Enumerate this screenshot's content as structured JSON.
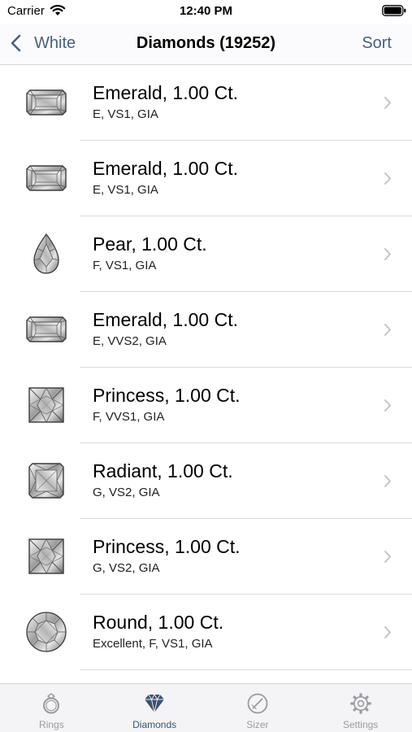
{
  "status_bar": {
    "carrier": "Carrier",
    "time": "12:40 PM",
    "icons": [
      "wifi-icon",
      "battery-icon"
    ]
  },
  "nav": {
    "back_label": "White",
    "title": "Diamonds (19252)",
    "sort_label": "Sort",
    "accent_color": "#4a5f7e"
  },
  "diamonds": [
    {
      "shape": "emerald",
      "title": "Emerald, 1.00 Ct.",
      "details": "E, VS1, GIA"
    },
    {
      "shape": "emerald",
      "title": "Emerald, 1.00 Ct.",
      "details": "E, VS1, GIA"
    },
    {
      "shape": "pear",
      "title": "Pear, 1.00 Ct.",
      "details": "F, VS1, GIA"
    },
    {
      "shape": "emerald",
      "title": "Emerald, 1.00 Ct.",
      "details": "E, VVS2, GIA"
    },
    {
      "shape": "princess",
      "title": "Princess, 1.00 Ct.",
      "details": "F, VVS1, GIA"
    },
    {
      "shape": "radiant",
      "title": "Radiant, 1.00 Ct.",
      "details": "G, VS2, GIA"
    },
    {
      "shape": "princess",
      "title": "Princess, 1.00 Ct.",
      "details": "G, VS2, GIA"
    },
    {
      "shape": "round",
      "title": "Round, 1.00 Ct.",
      "details": "Excellent, F, VS1, GIA"
    }
  ],
  "tabs": [
    {
      "label": "Rings",
      "icon": "ring-icon",
      "active": false
    },
    {
      "label": "Diamonds",
      "icon": "diamond-icon",
      "active": true
    },
    {
      "label": "Sizer",
      "icon": "sizer-icon",
      "active": false
    },
    {
      "label": "Settings",
      "icon": "gear-icon",
      "active": false
    }
  ]
}
